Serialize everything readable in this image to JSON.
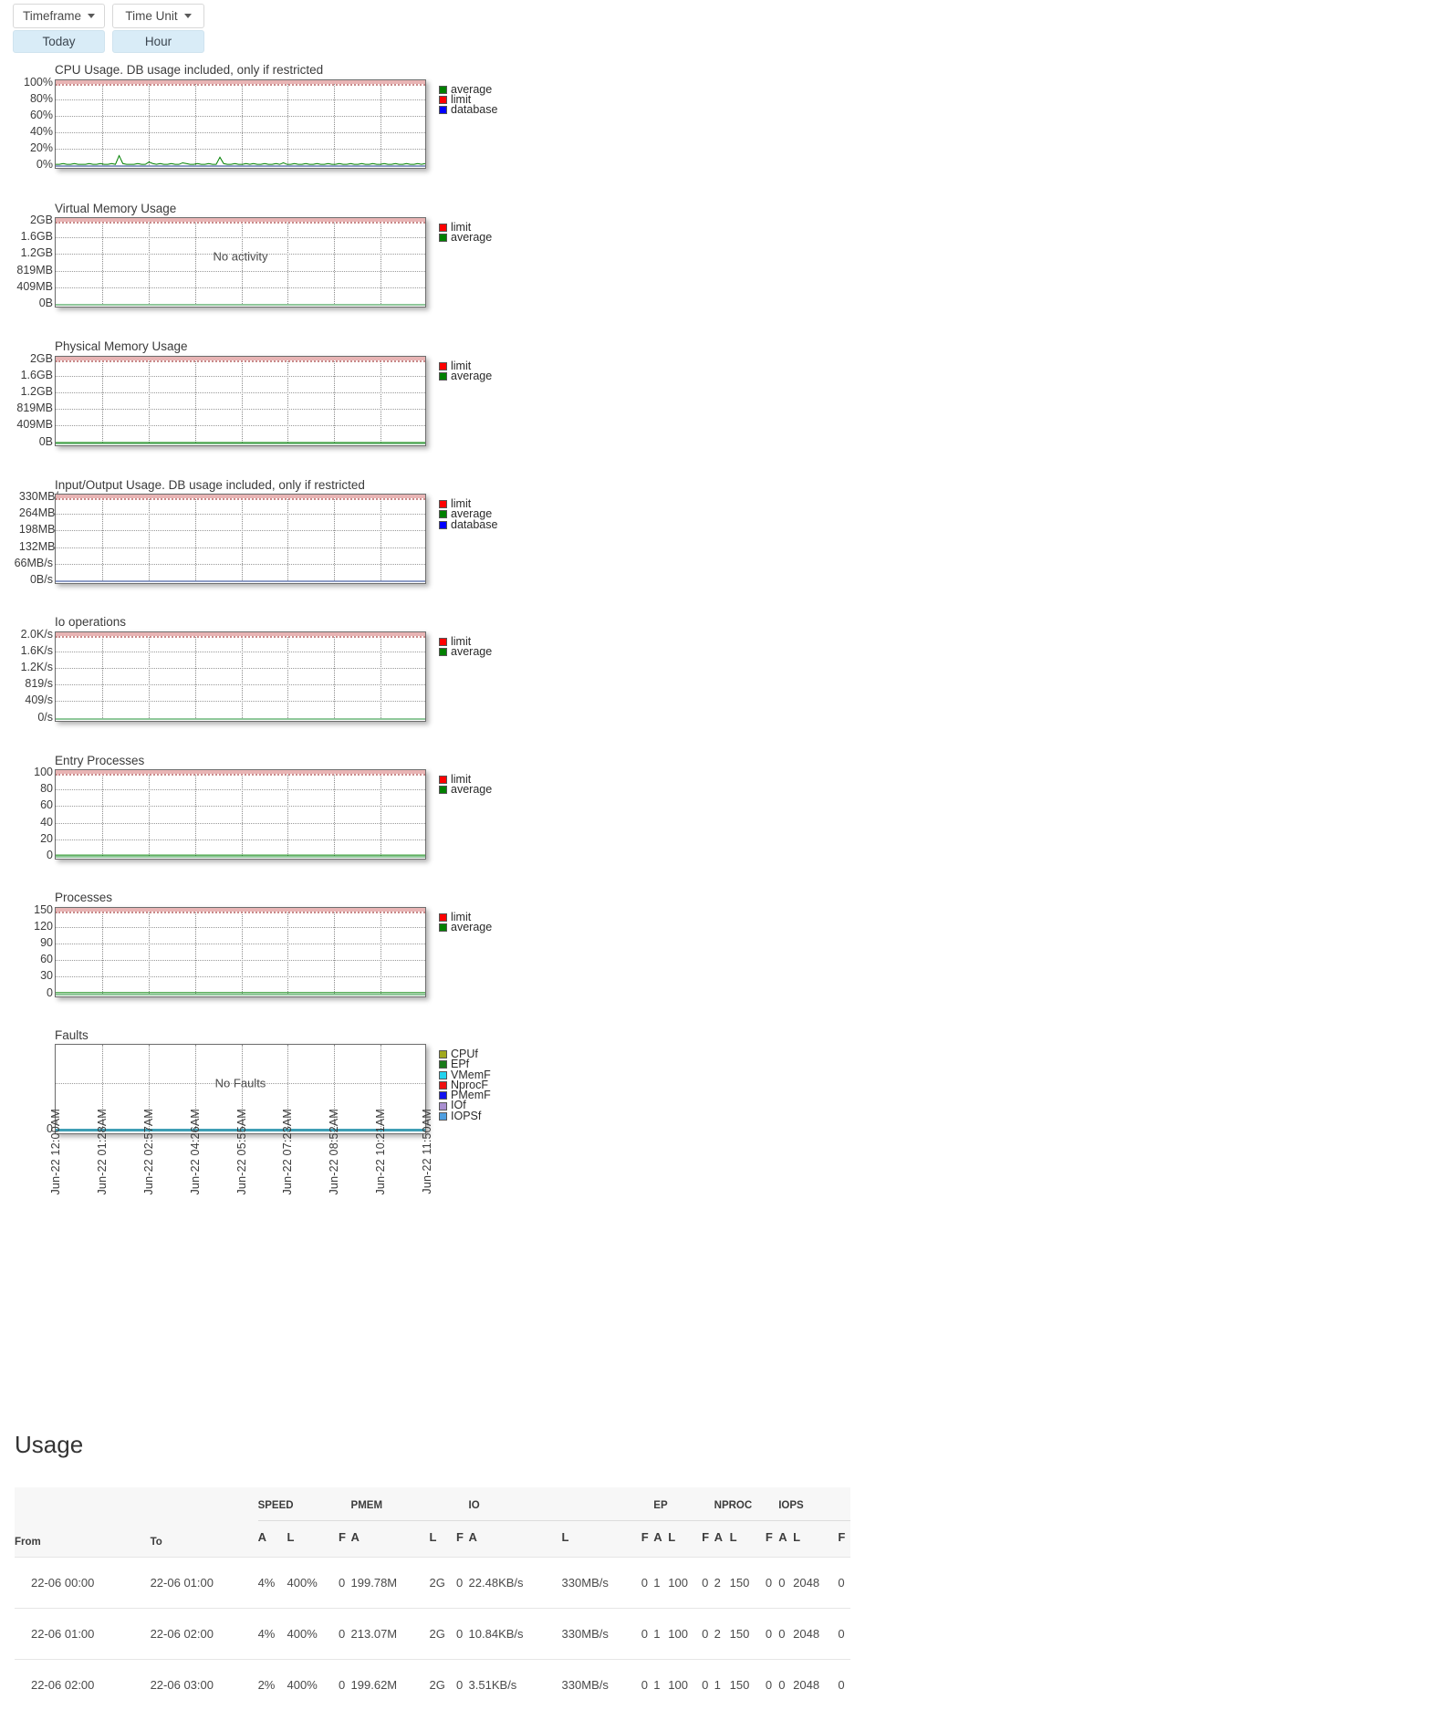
{
  "toolbar": {
    "dropdowns": [
      {
        "label": "Timeframe",
        "icon": "chevron-down-icon"
      },
      {
        "label": "Time Unit",
        "icon": "chevron-down-icon"
      }
    ],
    "selections": [
      {
        "label": "Today"
      },
      {
        "label": "Hour"
      }
    ]
  },
  "colors": {
    "average": "#008000",
    "limit": "#ff0000",
    "database": "#0000ff",
    "cpuf": "#a0a81e",
    "epf": "#1a7a1a",
    "vmemf": "#22d3ee",
    "nprocf": "#ee1111",
    "pmemf": "#1111ee",
    "iof": "#a98fd0",
    "iopsf": "#4f9fe0",
    "limit_band": "#e8b4b4",
    "baseline_green": "#8fc79a",
    "baseline_blue": "#8f9ec7",
    "baseline_teal": "#3f9fb5",
    "selected_button": "#d9ecf7"
  },
  "x_ticks": [
    "Jun-22 12:00AM",
    "Jun-22 01:28AM",
    "Jun-22 02:57AM",
    "Jun-22 04:26AM",
    "Jun-22 05:55AM",
    "Jun-22 07:23AM",
    "Jun-22 08:52AM",
    "Jun-22 10:21AM",
    "Jun-22 11:50AM"
  ],
  "chart_data": [
    {
      "type": "line",
      "title": "CPU Usage. DB usage included, only if restricted",
      "xlabel": "",
      "ylabel": "",
      "yticks": [
        "100%",
        "80%",
        "60%",
        "40%",
        "20%",
        "0%"
      ],
      "ylim": [
        0,
        100
      ],
      "grid": true,
      "legend_position": "right",
      "legend": [
        {
          "name": "average",
          "color": "#008000"
        },
        {
          "name": "limit",
          "color": "#ff0000"
        },
        {
          "name": "database",
          "color": "#0000ff"
        }
      ],
      "series": [
        {
          "name": "limit",
          "constant": 100
        },
        {
          "name": "database",
          "constant": 0
        },
        {
          "name": "average",
          "note": "near-zero with small spikes up to ~12%",
          "values": [
            1,
            1,
            2,
            1,
            1,
            2,
            1,
            1,
            1,
            2,
            1,
            1,
            2,
            1,
            1,
            2,
            1,
            12,
            2,
            1,
            1,
            1,
            2,
            1,
            1,
            4,
            2,
            1,
            2,
            1,
            1,
            2,
            1,
            1,
            3,
            2,
            1,
            1,
            2,
            1,
            1,
            2,
            1,
            1,
            10,
            2,
            1,
            1,
            2,
            1,
            1,
            2,
            1,
            2,
            1,
            1,
            2,
            1,
            1,
            2,
            1,
            3,
            1,
            1,
            2,
            1,
            1,
            2,
            1,
            1,
            2,
            1,
            1,
            2,
            1,
            1,
            2,
            1,
            1,
            2,
            1,
            1,
            2,
            1,
            1,
            2,
            1,
            1,
            2,
            1,
            1,
            2,
            1,
            1,
            2,
            1,
            1,
            2,
            1,
            2
          ]
        }
      ]
    },
    {
      "type": "line",
      "title": "Virtual Memory Usage",
      "xlabel": "",
      "ylabel": "",
      "yticks": [
        "2GB",
        "1.6GB",
        "1.2GB",
        "819MB",
        "409MB",
        "0B"
      ],
      "ylim": [
        0,
        2147483648
      ],
      "grid": true,
      "empty_message": "No activity",
      "legend_position": "right",
      "legend": [
        {
          "name": "limit",
          "color": "#ff0000"
        },
        {
          "name": "average",
          "color": "#008000"
        }
      ],
      "series": [
        {
          "name": "limit",
          "constant": 2147483648
        },
        {
          "name": "average",
          "constant": 0
        }
      ]
    },
    {
      "type": "line",
      "title": "Physical Memory Usage",
      "xlabel": "",
      "ylabel": "",
      "yticks": [
        "2GB",
        "1.6GB",
        "1.2GB",
        "819MB",
        "409MB",
        "0B"
      ],
      "ylim": [
        0,
        2147483648
      ],
      "grid": true,
      "legend_position": "right",
      "legend": [
        {
          "name": "limit",
          "color": "#ff0000"
        },
        {
          "name": "average",
          "color": "#008000"
        }
      ],
      "series": [
        {
          "name": "limit",
          "constant": 2147483648
        },
        {
          "name": "average",
          "note": "fluctuating near 200MB with frequent drops to 0",
          "values": [
            190,
            195,
            200,
            205,
            198,
            210,
            205,
            200,
            195,
            210,
            215,
            205,
            0,
            200,
            205,
            210,
            200,
            195,
            205,
            215,
            210,
            200,
            0,
            205,
            210,
            200,
            195,
            0,
            205,
            0,
            210,
            0,
            200,
            0,
            215,
            0,
            205,
            210,
            0,
            200,
            0,
            195,
            205,
            0,
            210,
            200,
            0,
            205,
            210,
            200,
            0,
            195,
            205,
            210,
            200,
            0,
            205,
            0,
            210,
            200,
            195,
            205,
            210,
            200,
            0,
            205,
            210,
            200,
            195,
            205,
            210,
            200,
            205,
            210,
            200,
            195,
            205,
            210,
            200,
            205,
            210,
            200,
            195,
            205,
            210,
            200,
            205,
            210,
            200,
            195,
            205,
            0,
            210,
            200,
            205,
            210,
            200,
            195,
            205,
            210
          ]
        }
      ]
    },
    {
      "type": "line",
      "title": "Input/Output Usage. DB usage included, only if restricted",
      "xlabel": "",
      "ylabel": "",
      "yticks": [
        "330MB/",
        "264MB/",
        "198MB/",
        "132MB/",
        "66MB/s",
        "0B/s"
      ],
      "ylim": [
        0,
        330
      ],
      "grid": true,
      "legend_position": "right",
      "legend": [
        {
          "name": "limit",
          "color": "#ff0000"
        },
        {
          "name": "average",
          "color": "#008000"
        },
        {
          "name": "database",
          "color": "#0000ff"
        }
      ],
      "series": [
        {
          "name": "limit",
          "constant": 330
        },
        {
          "name": "average",
          "constant": 0
        },
        {
          "name": "database",
          "constant": 0
        }
      ]
    },
    {
      "type": "line",
      "title": "Io operations",
      "xlabel": "",
      "ylabel": "",
      "yticks": [
        "2.0K/s",
        "1.6K/s",
        "1.2K/s",
        "819/s",
        "409/s",
        "0/s"
      ],
      "ylim": [
        0,
        2048
      ],
      "grid": true,
      "legend_position": "right",
      "legend": [
        {
          "name": "limit",
          "color": "#ff0000"
        },
        {
          "name": "average",
          "color": "#008000"
        }
      ],
      "series": [
        {
          "name": "limit",
          "constant": 2048
        },
        {
          "name": "average",
          "constant": 0
        }
      ]
    },
    {
      "type": "line",
      "title": "Entry Processes",
      "xlabel": "",
      "ylabel": "",
      "yticks": [
        "100",
        "80",
        "60",
        "40",
        "20",
        "0"
      ],
      "ylim": [
        0,
        100
      ],
      "grid": true,
      "legend_position": "right",
      "legend": [
        {
          "name": "limit",
          "color": "#ff0000"
        },
        {
          "name": "average",
          "color": "#008000"
        }
      ],
      "series": [
        {
          "name": "limit",
          "constant": 100
        },
        {
          "name": "average",
          "note": "flat near 1",
          "values": [
            1,
            1,
            1,
            1,
            1,
            1,
            1,
            1,
            1,
            1,
            1,
            1,
            1,
            1,
            1,
            1,
            1,
            1,
            1,
            1,
            1,
            1,
            1,
            1,
            1,
            1,
            1,
            1,
            1,
            1,
            1,
            1,
            1,
            1,
            1,
            1,
            1,
            1,
            1,
            1,
            1,
            1,
            1,
            1,
            1,
            1,
            1,
            1,
            1,
            1,
            1,
            1,
            1,
            1,
            1,
            1,
            1,
            1,
            1,
            1,
            1,
            1,
            1,
            1,
            1,
            1,
            1,
            1,
            1,
            1,
            1,
            1,
            1,
            1,
            1,
            1,
            1,
            1,
            1,
            1,
            1,
            1,
            1,
            1,
            1,
            1,
            1,
            1,
            1,
            1,
            1,
            1,
            1,
            1,
            1,
            1,
            1,
            1,
            1,
            1
          ]
        }
      ]
    },
    {
      "type": "line",
      "title": "Processes",
      "xlabel": "",
      "ylabel": "",
      "yticks": [
        "150",
        "120",
        "90",
        "60",
        "30",
        "0"
      ],
      "ylim": [
        0,
        150
      ],
      "grid": true,
      "legend_position": "right",
      "legend": [
        {
          "name": "limit",
          "color": "#ff0000"
        },
        {
          "name": "average",
          "color": "#008000"
        }
      ],
      "series": [
        {
          "name": "limit",
          "constant": 150
        },
        {
          "name": "average",
          "note": "flat near 2",
          "values": [
            2,
            2,
            2,
            2,
            2,
            2,
            2,
            2,
            2,
            2,
            2,
            2,
            2,
            2,
            2,
            2,
            2,
            2,
            2,
            2,
            2,
            2,
            2,
            2,
            2,
            2,
            2,
            2,
            2,
            2,
            2,
            2,
            2,
            2,
            2,
            2,
            2,
            2,
            2,
            2,
            2,
            2,
            2,
            2,
            2,
            2,
            2,
            2,
            2,
            2,
            2,
            2,
            2,
            2,
            2,
            2,
            2,
            2,
            2,
            2,
            2,
            2,
            2,
            2,
            2,
            2,
            2,
            2,
            2,
            2,
            2,
            2,
            2,
            2,
            2,
            2,
            2,
            2,
            2,
            2,
            2,
            2,
            2,
            2,
            2,
            2,
            2,
            2,
            2,
            2,
            2,
            2,
            2,
            2,
            2,
            2,
            2,
            2,
            2,
            2
          ]
        }
      ]
    },
    {
      "type": "line",
      "title": "Faults",
      "xlabel": "",
      "ylabel": "",
      "yticks": [
        "0"
      ],
      "ylim": [
        0,
        1
      ],
      "grid": true,
      "empty_message": "No Faults",
      "legend_position": "right",
      "legend": [
        {
          "name": "CPUf",
          "color": "#a0a81e"
        },
        {
          "name": "EPf",
          "color": "#1a7a1a"
        },
        {
          "name": "VMemF",
          "color": "#22d3ee"
        },
        {
          "name": "NprocF",
          "color": "#ee1111"
        },
        {
          "name": "PMemF",
          "color": "#1111ee"
        },
        {
          "name": "IOf",
          "color": "#a98fd0"
        },
        {
          "name": "IOPSf",
          "color": "#4f9fe0"
        }
      ],
      "series": [
        {
          "name": "faults",
          "constant": 0
        }
      ]
    }
  ],
  "usage": {
    "heading": "Usage",
    "row_headers": [
      "From",
      "To"
    ],
    "group_headers": [
      "SPEED",
      "PMEM",
      "IO",
      "EP",
      "NPROC",
      "IOPS"
    ],
    "sub_headers": [
      "A",
      "L",
      "F"
    ],
    "rows": [
      {
        "from": "22-06 00:00",
        "to": "22-06 01:00",
        "cells": [
          "4%",
          "400%",
          "0",
          "199.78M",
          "2G",
          "0",
          "22.48KB/s",
          "330MB/s",
          "0",
          "1",
          "100",
          "0",
          "2",
          "150",
          "0",
          "0",
          "2048",
          "0"
        ]
      },
      {
        "from": "22-06 01:00",
        "to": "22-06 02:00",
        "cells": [
          "4%",
          "400%",
          "0",
          "213.07M",
          "2G",
          "0",
          "10.84KB/s",
          "330MB/s",
          "0",
          "1",
          "100",
          "0",
          "2",
          "150",
          "0",
          "0",
          "2048",
          "0"
        ]
      },
      {
        "from": "22-06 02:00",
        "to": "22-06 03:00",
        "cells": [
          "2%",
          "400%",
          "0",
          "199.62M",
          "2G",
          "0",
          "3.51KB/s",
          "330MB/s",
          "0",
          "1",
          "100",
          "0",
          "1",
          "150",
          "0",
          "0",
          "2048",
          "0"
        ]
      }
    ]
  }
}
